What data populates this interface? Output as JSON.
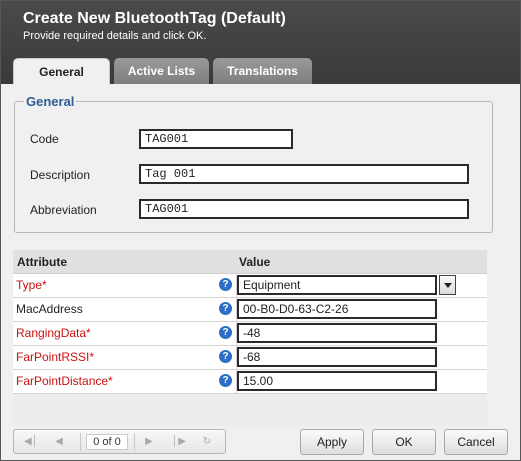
{
  "dialog": {
    "title": "Create New BluetoothTag (Default)",
    "subtitle": "Provide required details and click OK."
  },
  "tabs": [
    {
      "label": "General",
      "active": true
    },
    {
      "label": "Active Lists",
      "active": false
    },
    {
      "label": "Translations",
      "active": false
    }
  ],
  "general": {
    "legend": "General",
    "fields": [
      {
        "label": "Code",
        "value": "TAG001"
      },
      {
        "label": "Description",
        "value": "Tag 001"
      },
      {
        "label": "Abbreviation",
        "value": "TAG001"
      }
    ]
  },
  "grid": {
    "headers": {
      "attribute": "Attribute",
      "value": "Value"
    },
    "rows": [
      {
        "attribute": "Type*",
        "required": true,
        "value": "Equipment",
        "kind": "select"
      },
      {
        "attribute": "MacAddress",
        "required": false,
        "value": "00-B0-D0-63-C2-26",
        "kind": "text"
      },
      {
        "attribute": "RangingData*",
        "required": true,
        "value": "-48",
        "kind": "text"
      },
      {
        "attribute": "FarPointRSSI*",
        "required": true,
        "value": "-68",
        "kind": "text"
      },
      {
        "attribute": "FarPointDistance*",
        "required": true,
        "value": "15.00",
        "kind": "text"
      }
    ],
    "help_glyph": "?"
  },
  "pager": {
    "info": "0 of 0",
    "icons": [
      "first-page-icon",
      "prev-page-icon",
      "next-page-icon",
      "last-page-icon",
      "refresh-icon"
    ]
  },
  "buttons": {
    "apply": "Apply",
    "ok": "OK",
    "cancel": "Cancel"
  },
  "colors": {
    "header_bg": "#3f3f3f",
    "legend": "#2e5d94",
    "required": "#cc1111",
    "help": "#2b6fc6"
  }
}
